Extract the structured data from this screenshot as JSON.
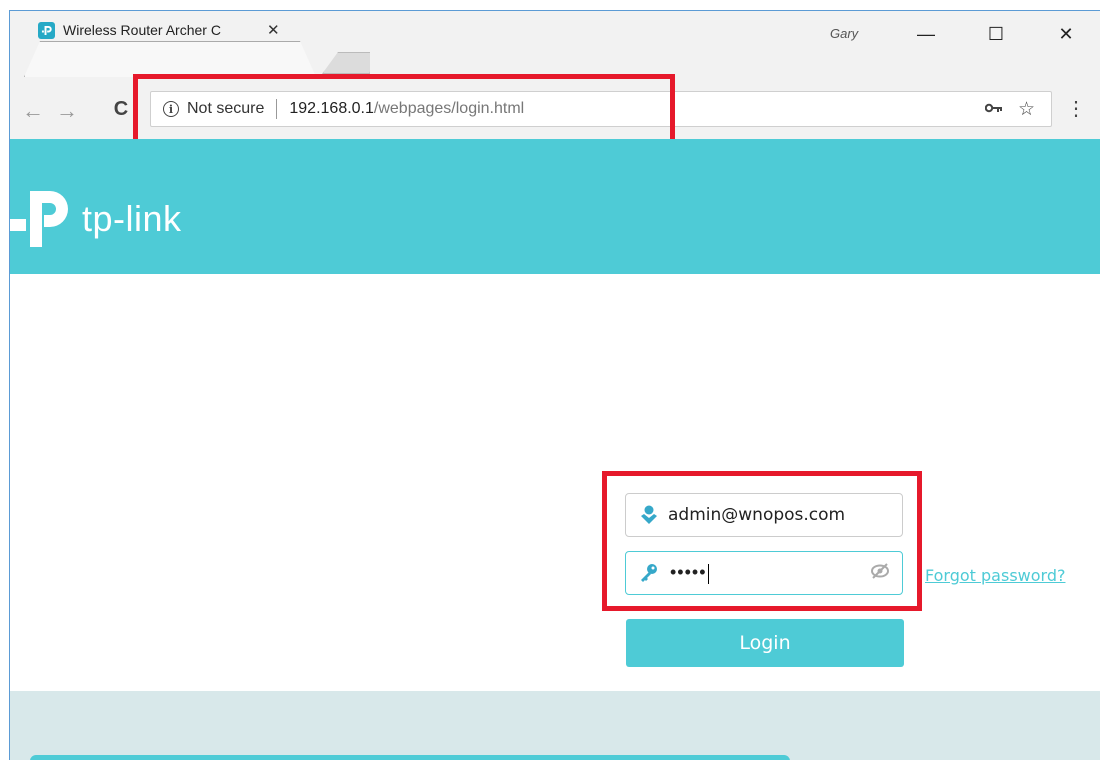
{
  "browser": {
    "tab_title": "Wireless Router Archer C",
    "tab_close": "✕",
    "profile_name": "Gary",
    "window_controls": {
      "minimize": "—",
      "maximize": "☐",
      "close": "✕"
    },
    "nav": {
      "back": "←",
      "forward": "→",
      "reload": "C"
    },
    "address": {
      "security_icon": "i",
      "security_text": "Not secure",
      "host": "192.168.0.1",
      "path": "/webpages/login.html"
    },
    "icons": {
      "key": "key-icon",
      "star": "star-icon",
      "menu": "menu-icon"
    }
  },
  "page": {
    "brand": "tp-link",
    "username_value": "admin@wnopos.com",
    "password_mask": "•••••",
    "forgot_label": "Forgot password?",
    "login_label": "Login"
  },
  "colors": {
    "accent": "#4ecbd6",
    "highlight": "#e6192b"
  }
}
